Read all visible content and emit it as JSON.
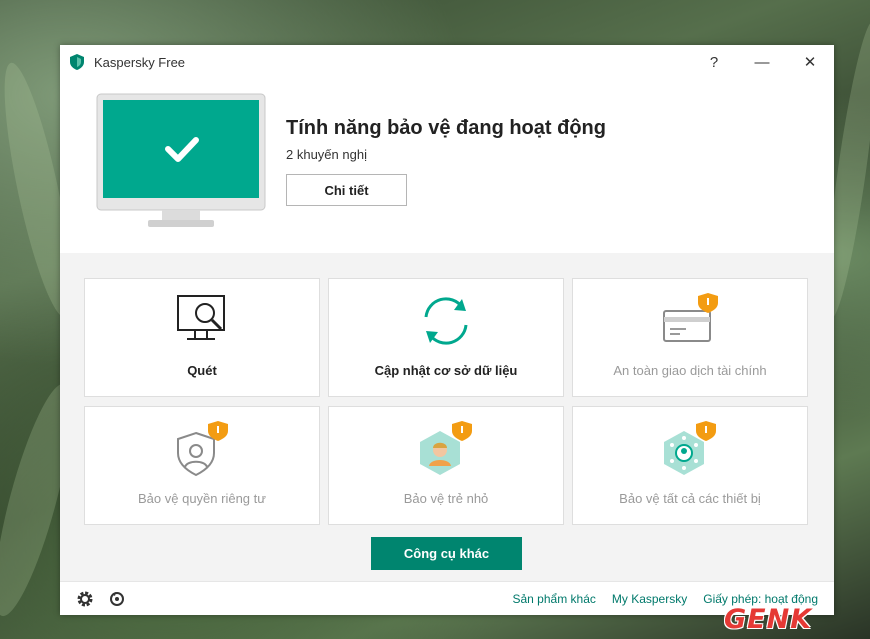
{
  "window": {
    "title": "Kaspersky Free",
    "controls": {
      "help": "?",
      "minimize": "—",
      "close": "✕"
    }
  },
  "hero": {
    "status_title": "Tính năng bảo vệ đang hoạt động",
    "status_subtitle": "2 khuyến nghị",
    "details_button": "Chi tiết"
  },
  "tiles": [
    {
      "label": "Quét",
      "icon": "scan-monitor-icon",
      "enabled": true
    },
    {
      "label": "Cập nhật cơ sở dữ liệu",
      "icon": "update-sync-icon",
      "enabled": true
    },
    {
      "label": "An toàn giao dịch tài chính",
      "icon": "safe-money-card-icon",
      "enabled": false
    },
    {
      "label": "Bảo vệ quyền riêng tư",
      "icon": "privacy-shield-icon",
      "enabled": false
    },
    {
      "label": "Bảo vệ trẻ nhỏ",
      "icon": "child-protection-icon",
      "enabled": false
    },
    {
      "label": "Bảo vệ tất cả các thiết bị",
      "icon": "all-devices-icon",
      "enabled": false
    }
  ],
  "more_tools_button": "Công cụ khác",
  "footer": {
    "links": [
      "Sản phẩm khác",
      "My Kaspersky",
      "Giấy phép: hoạt động"
    ],
    "icons": [
      "settings-gear-icon",
      "support-icon"
    ]
  },
  "watermark": "GENK",
  "colors": {
    "accent": "#00856f",
    "monitor_screen": "#00a88e",
    "premium_badge": "#f39c12",
    "disabled_text": "#9a9a9a"
  }
}
